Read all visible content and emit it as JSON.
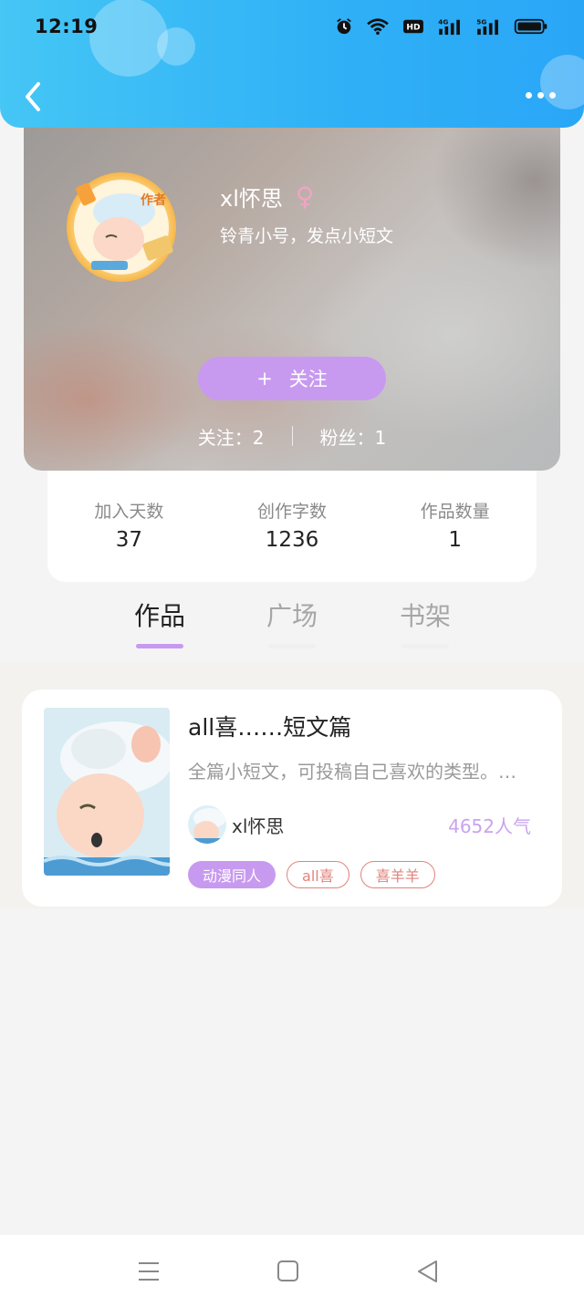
{
  "status_bar": {
    "time": "12:19",
    "icons": [
      "alarm-icon",
      "wifi-icon",
      "hd-icon",
      "4g-signal-icon",
      "5g-signal-icon",
      "battery-icon"
    ]
  },
  "nav": {
    "back_icon": "chevron-left-icon",
    "more_icon": "more-dots-icon"
  },
  "profile": {
    "username": "xl怀思",
    "gender_symbol": "♀",
    "bio": "铃青小号，发点小短文",
    "avatar_badge": "作者",
    "follow_button": {
      "plus": "+",
      "label": "关注"
    },
    "following": "关注：2",
    "followers": "粉丝：1"
  },
  "stats": [
    {
      "label": "加入天数",
      "value": "37"
    },
    {
      "label": "创作字数",
      "value": "1236"
    },
    {
      "label": "作品数量",
      "value": "1"
    }
  ],
  "tabs": [
    {
      "label": "作品",
      "active": true
    },
    {
      "label": "广场",
      "active": false
    },
    {
      "label": "书架",
      "active": false
    }
  ],
  "works": [
    {
      "title": "all喜……短文篇",
      "description": "全篇小短文，可投稿自己喜欢的类型。…",
      "author": "xl怀思",
      "popularity": "4652人气",
      "tags": [
        {
          "label": "动漫同人",
          "style": "fill"
        },
        {
          "label": "all喜",
          "style": "outline"
        },
        {
          "label": "喜羊羊",
          "style": "outline"
        }
      ]
    }
  ],
  "system_nav": {
    "menu_icon": "menu-icon",
    "home_icon": "home-square-icon",
    "back_icon": "back-triangle-icon"
  },
  "colors": {
    "header_gradient_start": "#45c6f5",
    "header_gradient_end": "#2aa6f7",
    "accent_purple": "#c79af0",
    "tag_outline": "#e0837b"
  }
}
